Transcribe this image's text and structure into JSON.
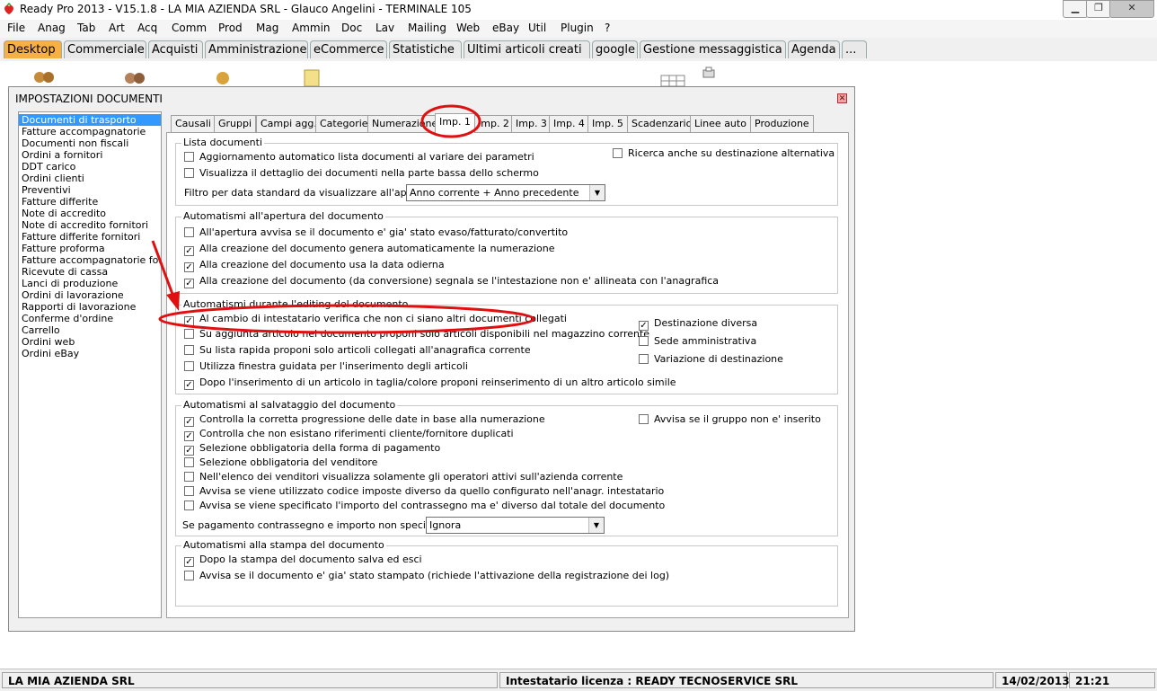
{
  "window": {
    "title": "Ready Pro 2013 - V15.1.8 - LA MIA AZIENDA SRL - Glauco Angelini - TERMINALE 105"
  },
  "menu": [
    "File",
    "Anag",
    "Tab",
    "Art",
    "Acq",
    "Comm",
    "Prod",
    "Mag",
    "Ammin",
    "Doc",
    "Lav",
    "Mailing",
    "Web",
    "eBay",
    "Util",
    "Plugin",
    "?"
  ],
  "top_tabs": [
    "Desktop",
    "Commerciale",
    "Acquisti",
    "Amministrazione",
    "eCommerce",
    "Statistiche",
    "Ultimi articoli creati",
    "google",
    "Gestione messaggistica",
    "Agenda",
    "..."
  ],
  "dialog": {
    "title": "IMPOSTAZIONI DOCUMENTI",
    "doc_types": [
      "Documenti di trasporto",
      "Fatture accompagnatorie",
      "Documenti non fiscali",
      "Ordini a fornitori",
      "DDT carico",
      "Ordini clienti",
      "Preventivi",
      "Fatture differite",
      "Note di accredito",
      "Note di accredito fornitori",
      "Fatture differite fornitori",
      "Fatture proforma",
      "Fatture accompagnatorie fornitori",
      "Ricevute di cassa",
      "Lanci di produzione",
      "Ordini di lavorazione",
      "Rapporti di lavorazione",
      "Conferme d'ordine",
      "Carrello",
      "Ordini web",
      "Ordini eBay"
    ],
    "tabs": [
      "Causali",
      "Gruppi",
      "Campi agg.",
      "Categorie",
      "Numerazione",
      "Imp. 1",
      "Imp. 2",
      "Imp. 3",
      "Imp. 4",
      "Imp. 5",
      "Scadenzario",
      "Linee auto",
      "Produzione"
    ],
    "groups": {
      "lista": {
        "title": "Lista documenti",
        "items": [
          {
            "label": "Aggiornamento automatico lista documenti al variare dei parametri",
            "checked": false
          },
          {
            "label": "Visualizza il dettaglio dei documenti nella parte bassa dello schermo",
            "checked": false
          },
          {
            "label": "Ricerca anche su destinazione alternativa",
            "checked": false
          }
        ],
        "filter_label": "Filtro per data standard da visualizzare all'apertura :",
        "filter_value": "Anno corrente + Anno precedente"
      },
      "apertura": {
        "title": "Automatismi all'apertura del documento",
        "items": [
          {
            "label": "All'apertura avvisa se il documento e' gia' stato evaso/fatturato/convertito",
            "checked": false
          },
          {
            "label": "Alla creazione del documento genera automaticamente la numerazione",
            "checked": true
          },
          {
            "label": "Alla creazione del documento usa la data odierna",
            "checked": true
          },
          {
            "label": "Alla creazione del documento (da conversione) segnala se l'intestazione non e' allineata con l'anagrafica",
            "checked": true
          }
        ]
      },
      "editing": {
        "title": "Automatismi durante l'editing del documento",
        "items": [
          {
            "label": "Al cambio di intestatario verifica che non ci siano altri documenti collegati",
            "checked": true
          },
          {
            "label": "Su aggiunta articolo nel documento proponi solo articoli disponibili nel magazzino corrente",
            "checked": false
          },
          {
            "label": "Su lista rapida proponi solo articoli collegati all'anagrafica corrente",
            "checked": false
          },
          {
            "label": "Utilizza finestra guidata per l'inserimento degli articoli",
            "checked": false
          },
          {
            "label": "Dopo l'inserimento di un articolo in taglia/colore proponi reinserimento di un altro articolo simile",
            "checked": true
          }
        ],
        "right_items": [
          {
            "label": "Destinazione diversa",
            "checked": true
          },
          {
            "label": "Sede amministrativa",
            "checked": false
          },
          {
            "label": "Variazione di destinazione",
            "checked": false
          }
        ]
      },
      "salvataggio": {
        "title": "Automatismi al salvataggio del documento",
        "items": [
          {
            "label": "Controlla la corretta progressione delle date in base alla numerazione",
            "checked": true
          },
          {
            "label": "Controlla che non esistano riferimenti cliente/fornitore duplicati",
            "checked": true
          },
          {
            "label": "Selezione obbligatoria della forma di pagamento",
            "checked": true
          },
          {
            "label": "Selezione obbligatoria del venditore",
            "checked": false
          },
          {
            "label": "Nell'elenco dei venditori visualizza solamente gli operatori attivi sull'azienda corrente",
            "checked": false
          },
          {
            "label": "Avvisa se viene utilizzato codice imposte diverso da quello configurato nell'anagr. intestatario",
            "checked": false
          },
          {
            "label": "Avvisa se viene specificato l'importo del contrassegno ma e' diverso dal totale del documento",
            "checked": false
          }
        ],
        "right_item": {
          "label": "Avvisa se il gruppo non e' inserito",
          "checked": false
        },
        "contrassegno_label": "Se pagamento contrassegno e importo non specificato :",
        "contrassegno_value": "Ignora"
      },
      "stampa": {
        "title": "Automatismi alla stampa del documento",
        "items": [
          {
            "label": "Dopo la stampa del documento salva ed esci",
            "checked": true
          },
          {
            "label": "Avvisa se il documento e' gia' stato stampato (richiede l'attivazione della registrazione dei log)",
            "checked": false
          }
        ]
      }
    }
  },
  "status": {
    "company": "LA MIA AZIENDA SRL",
    "license": "Intestatario licenza : READY TECNOSERVICE SRL",
    "date": "14/02/2013",
    "time": "21:21"
  },
  "colors": {
    "accent": "#f6b043",
    "annotation": "#e01010",
    "selection": "#3399ff"
  }
}
